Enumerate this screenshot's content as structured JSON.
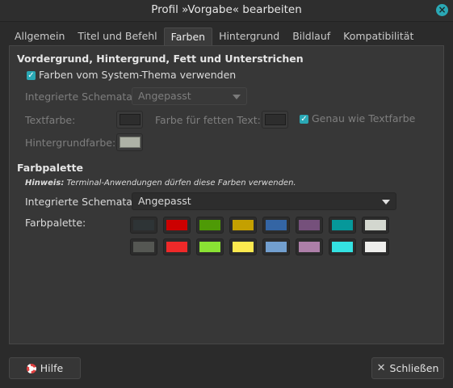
{
  "window": {
    "title": "Profil »Vorgabe« bearbeiten",
    "close_icon": "close-icon"
  },
  "tabs": [
    {
      "label": "Allgemein",
      "active": false
    },
    {
      "label": "Titel und Befehl",
      "active": false
    },
    {
      "label": "Farben",
      "active": true
    },
    {
      "label": "Hintergrund",
      "active": false
    },
    {
      "label": "Bildlauf",
      "active": false
    },
    {
      "label": "Kompatibilität",
      "active": false
    }
  ],
  "fg_section": {
    "heading": "Vordergrund, Hintergrund, Fett und Unterstrichen",
    "use_system_theme": {
      "label": "Farben vom System-Thema verwenden",
      "checked": true
    },
    "schemes_label": "Integrierte Schemata:",
    "schemes_value": "Angepasst",
    "text_color_label": "Textfarbe:",
    "text_color": "#2d2d2d",
    "bold_color_label": "Farbe für fetten Text:",
    "bold_color": "#2d2d2d",
    "same_as_text": {
      "label": "Genau wie Textfarbe",
      "checked": true
    },
    "bg_color_label": "Hintergrundfarbe:",
    "bg_color": "#aeb2a6"
  },
  "palette_section": {
    "heading": "Farbpalette",
    "hint_prefix": "Hinweis:",
    "hint_text": " Terminal-Anwendungen dürfen diese Farben verwenden.",
    "schemes_label": "Integrierte Schemata:",
    "schemes_value": "Angepasst",
    "palette_label": "Farbpalette:",
    "row1": [
      "#2e3436",
      "#cc0000",
      "#4e9a06",
      "#c4a000",
      "#3465a4",
      "#75507b",
      "#06989a",
      "#d3d7cf"
    ],
    "row2": [
      "#555753",
      "#ef2929",
      "#8ae234",
      "#fce94f",
      "#729fcf",
      "#ad7fa8",
      "#34e2e2",
      "#eeeeec"
    ]
  },
  "footer": {
    "help_label": "Hilfe",
    "help_icon": "lifebuoy-icon",
    "close_label": "Schließen",
    "close_icon": "x-icon",
    "close_symbol": "✕"
  }
}
